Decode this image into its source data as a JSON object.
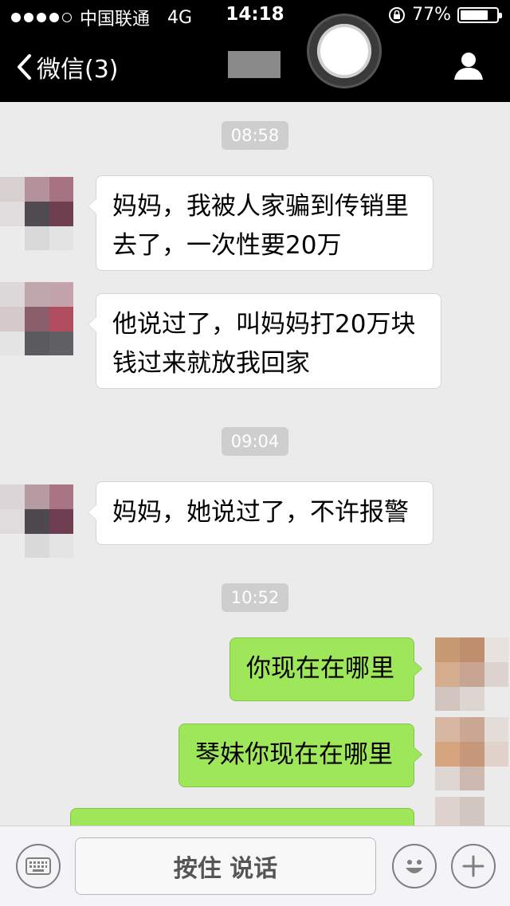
{
  "status_bar": {
    "carrier": "中国联通",
    "network": "4G",
    "time": "14:18",
    "battery": "77%",
    "battery_level": 0.77
  },
  "nav": {
    "back_label": "微信(3)"
  },
  "messages": [
    {
      "type": "timestamp",
      "text": "08:58"
    },
    {
      "type": "received",
      "lines": [
        "妈妈，我被人家骗到传销里",
        "去了，一次性要20万"
      ]
    },
    {
      "type": "received",
      "lines": [
        "他说过了，叫妈妈打20万块",
        "钱过来就放我回家"
      ]
    },
    {
      "type": "timestamp",
      "text": "09:04"
    },
    {
      "type": "received",
      "lines": [
        "妈妈，她说过了，不许报警"
      ]
    },
    {
      "type": "timestamp",
      "text": "10:52"
    },
    {
      "type": "sent",
      "lines": [
        "你现在在哪里"
      ]
    },
    {
      "type": "sent",
      "lines": [
        "琴妹你现在在哪里"
      ]
    },
    {
      "type": "sent",
      "lines": [
        ""
      ]
    }
  ],
  "input_bar": {
    "hold_to_talk": "按住 说话"
  },
  "colors": {
    "sent_bubble": "#9fe75a",
    "received_bubble": "#ffffff",
    "background": "#ebebeb",
    "navbar": "#000000"
  }
}
